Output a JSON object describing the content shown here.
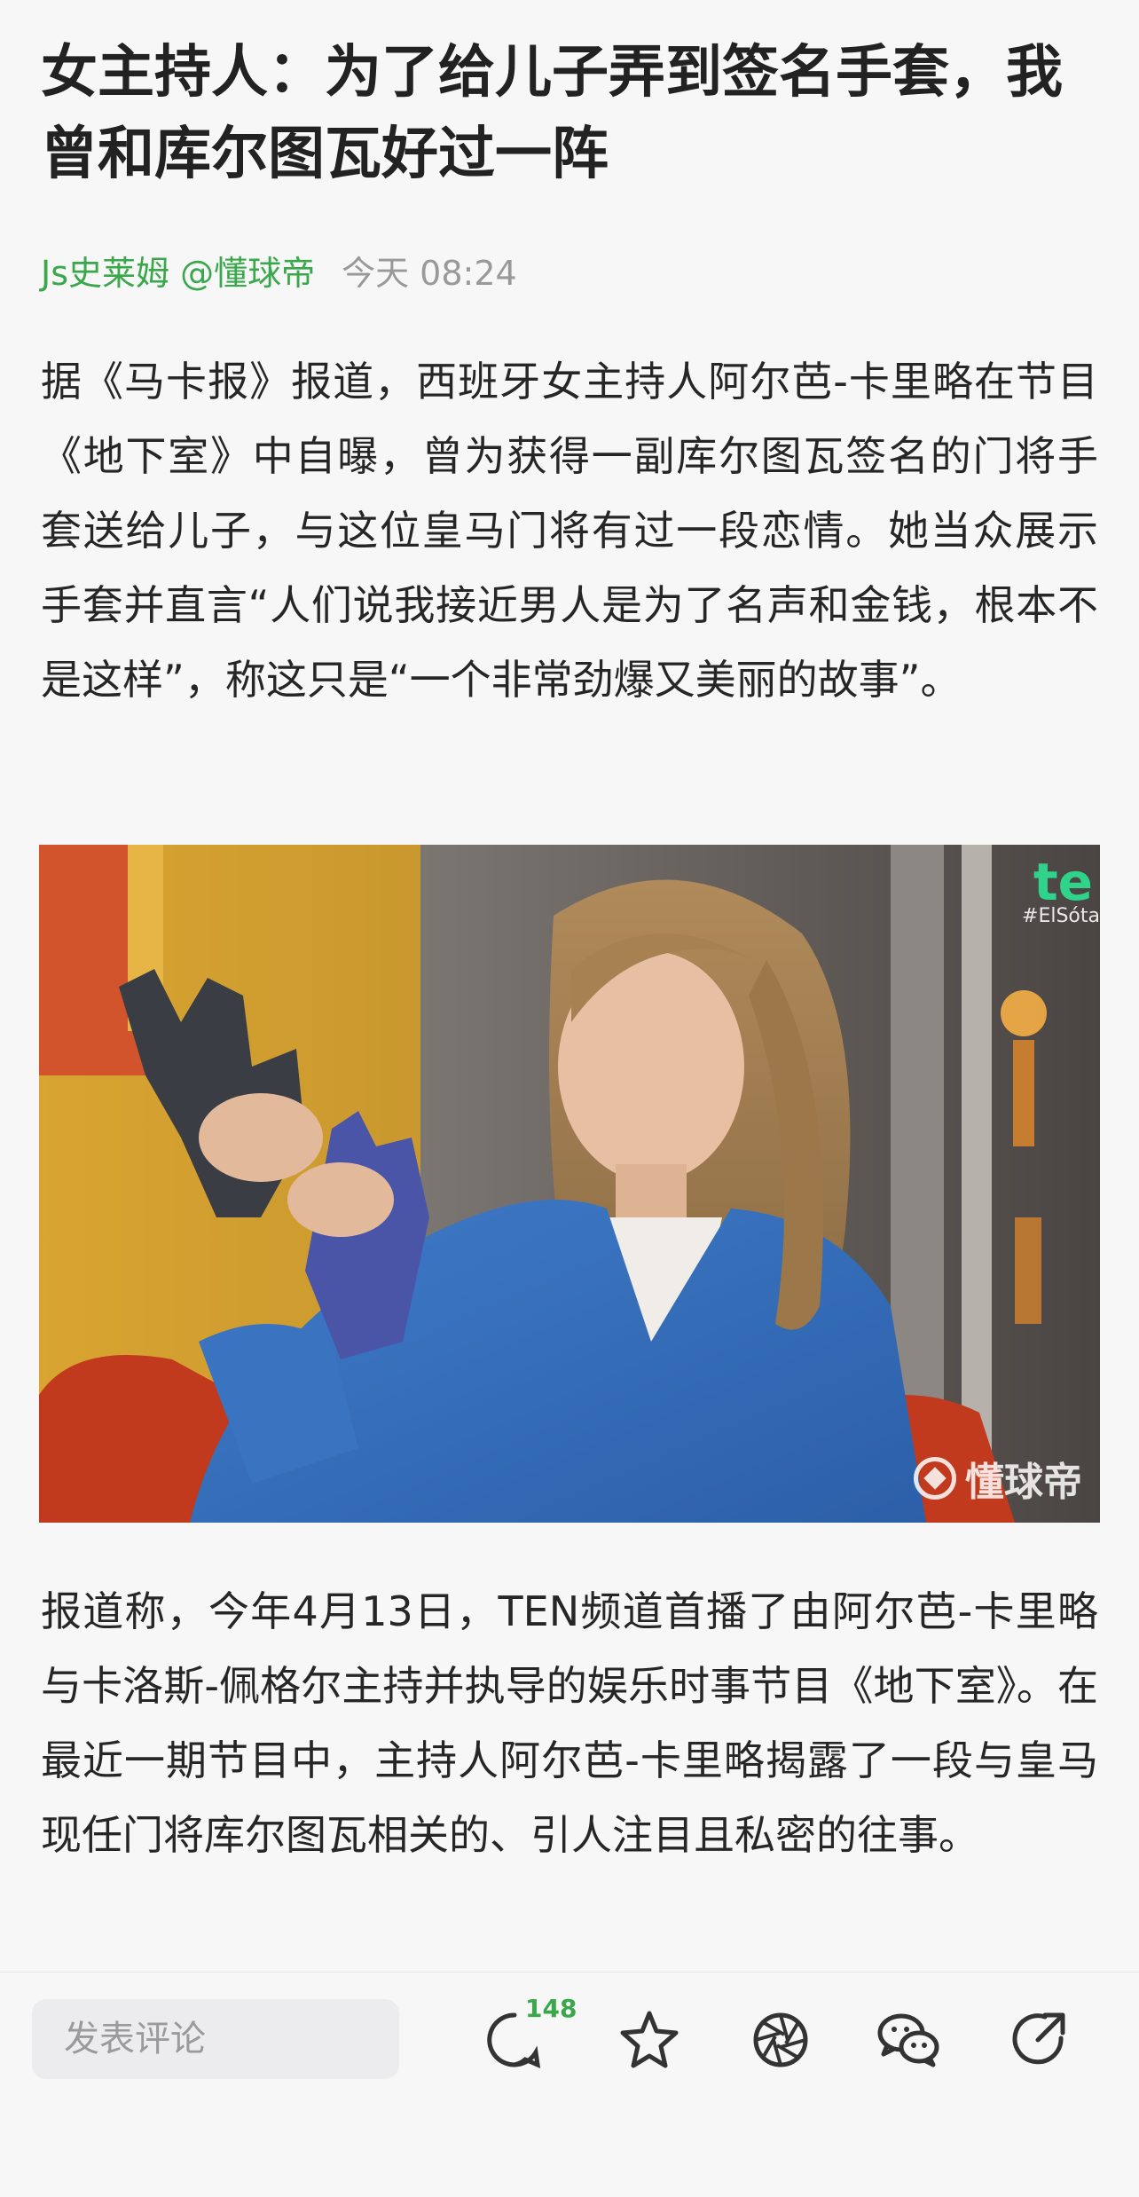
{
  "article": {
    "title": "女主持人：为了给儿子弄到签名手套，我曾和库尔图瓦好过一阵",
    "author": "Js史莱姆 @懂球帝",
    "time": "今天 08:24",
    "paragraph1": "据《马卡报》报道，西班牙女主持人阿尔芭-卡里略在节目《地下室》中自曝，曾为获得一副库尔图瓦签名的门将手套送给儿子，与这位皇马门将有过一段恋情。她当众展示手套并直言“人们说我接近男人是为了名声和金钱，根本不是这样”，称这只是“一个非常劲爆又美丽的故事”。",
    "paragraph2": "报道称，今年4月13日，TEN频道首播了由阿尔芭-卡里略与卡洛斯-佩格尔主持并执导的娱乐时事节目《地下室》。在最近一期节目中，主持人阿尔芭-卡里略揭露了一段与皇马现任门将库尔图瓦相关的、引人注目且私密的往事。"
  },
  "photo": {
    "watermark": "懂球帝",
    "channel_logo": "te",
    "hashtag": "#ElSóta"
  },
  "bottom_bar": {
    "comment_placeholder": "发表评论",
    "comment_count": "148",
    "icons": [
      "comment-icon",
      "star-icon",
      "moments-icon",
      "wechat-icon",
      "share-icon"
    ]
  }
}
